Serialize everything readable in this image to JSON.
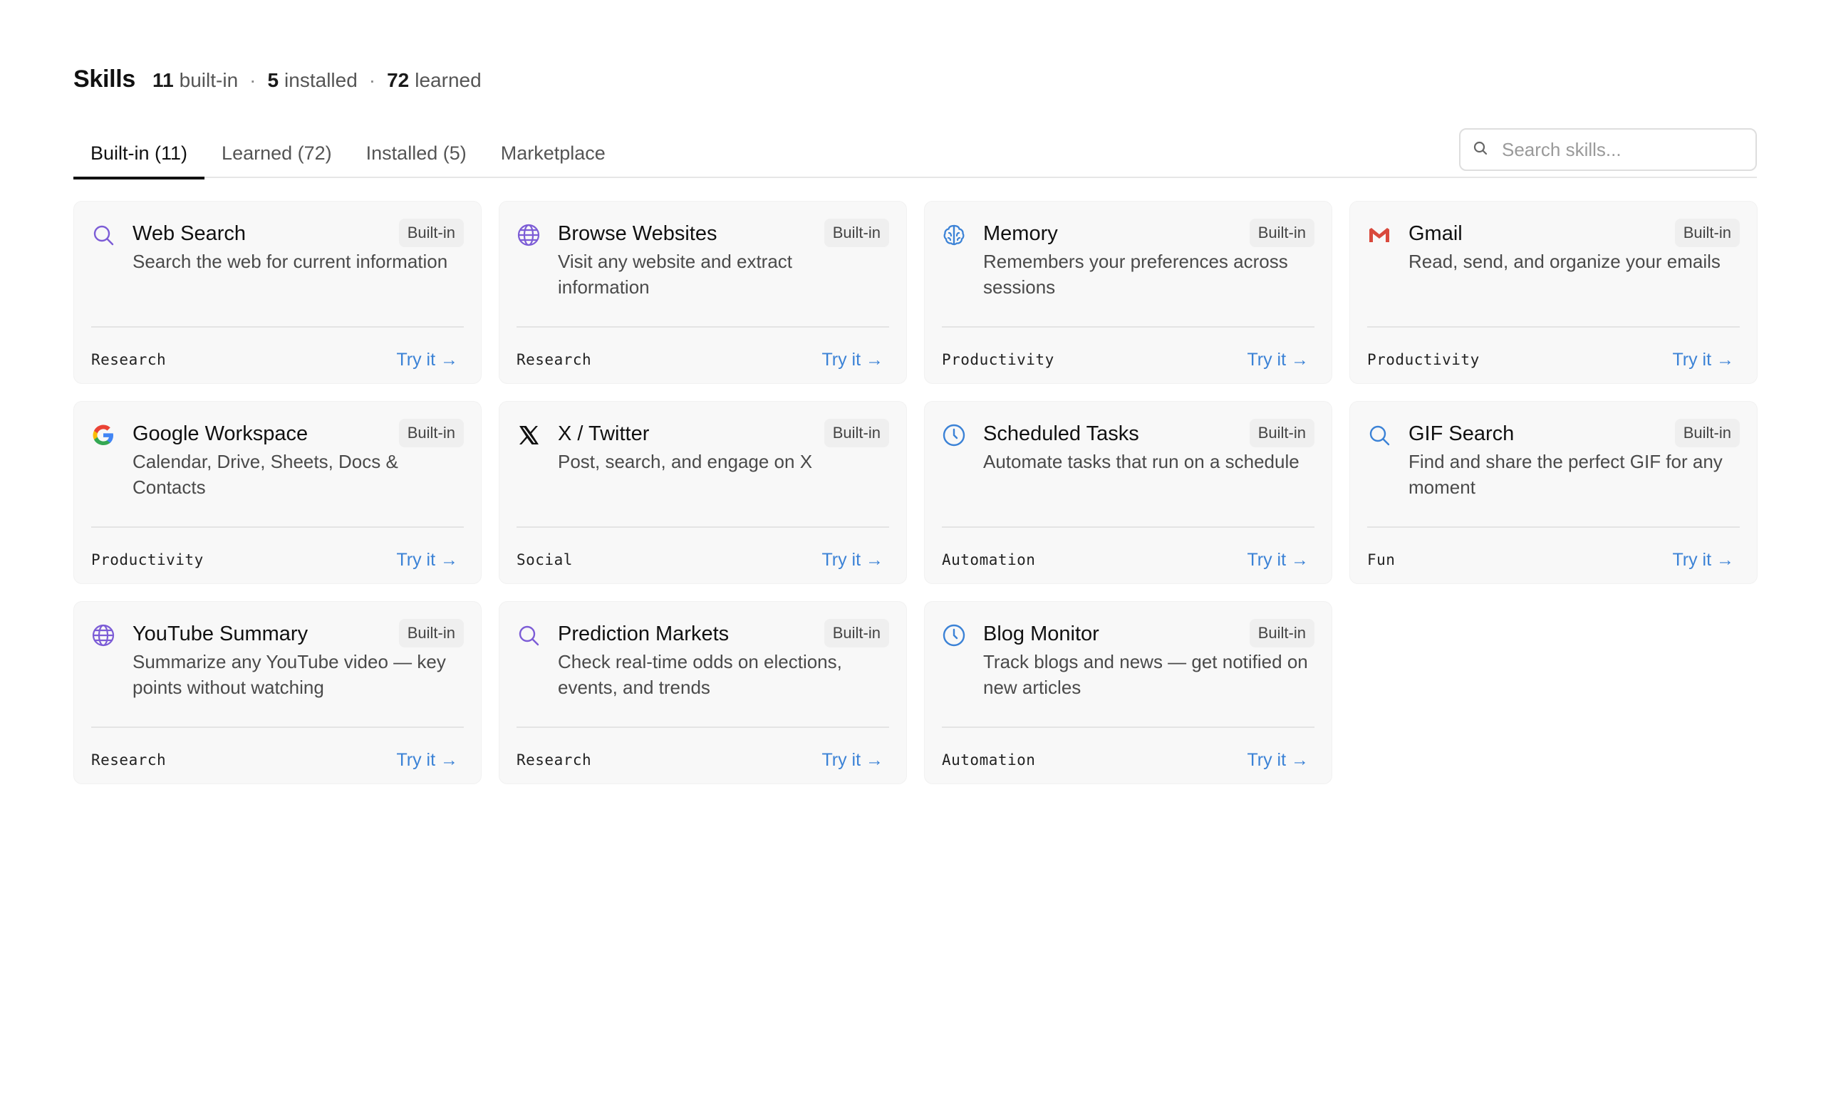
{
  "header": {
    "title": "Skills",
    "stats": [
      {
        "count": "11",
        "label": "built-in"
      },
      {
        "count": "5",
        "label": "installed"
      },
      {
        "count": "72",
        "label": "learned"
      }
    ],
    "separator": "·"
  },
  "tabs": [
    {
      "label": "Built-in (11)",
      "active": true
    },
    {
      "label": "Learned (72)",
      "active": false
    },
    {
      "label": "Installed (5)",
      "active": false
    },
    {
      "label": "Marketplace",
      "active": false
    }
  ],
  "search": {
    "placeholder": "Search skills...",
    "icon": "search-icon"
  },
  "try_label": "Try it →",
  "badge_label": "Built-in",
  "skills": [
    {
      "name": "Web Search",
      "description": "Search the web for current information",
      "category": "Research",
      "icon": "search-icon",
      "icon_color": "#7c5cd6"
    },
    {
      "name": "Browse Websites",
      "description": "Visit any website and extract information",
      "category": "Research",
      "icon": "globe-icon",
      "icon_color": "#7c5cd6"
    },
    {
      "name": "Memory",
      "description": "Remembers your preferences across sessions",
      "category": "Productivity",
      "icon": "brain-icon",
      "icon_color": "#3b82d6"
    },
    {
      "name": "Gmail",
      "description": "Read, send, and organize your emails",
      "category": "Productivity",
      "icon": "gmail-icon",
      "icon_color": "#d9493c"
    },
    {
      "name": "Google Workspace",
      "description": "Calendar, Drive, Sheets, Docs & Contacts",
      "category": "Productivity",
      "icon": "google-icon",
      "icon_color": "#4285f4"
    },
    {
      "name": "X / Twitter",
      "description": "Post, search, and engage on X",
      "category": "Social",
      "icon": "x-logo-icon",
      "icon_color": "#111111"
    },
    {
      "name": "Scheduled Tasks",
      "description": "Automate tasks that run on a schedule",
      "category": "Automation",
      "icon": "clock-icon",
      "icon_color": "#3b82d6"
    },
    {
      "name": "GIF Search",
      "description": "Find and share the perfect GIF for any moment",
      "category": "Fun",
      "icon": "search-icon",
      "icon_color": "#3b82d6"
    },
    {
      "name": "YouTube Summary",
      "description": "Summarize any YouTube video — key points without watching",
      "category": "Research",
      "icon": "globe-icon",
      "icon_color": "#7c5cd6"
    },
    {
      "name": "Prediction Markets",
      "description": "Check real-time odds on elections, events, and trends",
      "category": "Research",
      "icon": "search-icon",
      "icon_color": "#7c5cd6"
    },
    {
      "name": "Blog Monitor",
      "description": "Track blogs and news — get notified on new articles",
      "category": "Automation",
      "icon": "clock-icon",
      "icon_color": "#3b82d6"
    }
  ]
}
